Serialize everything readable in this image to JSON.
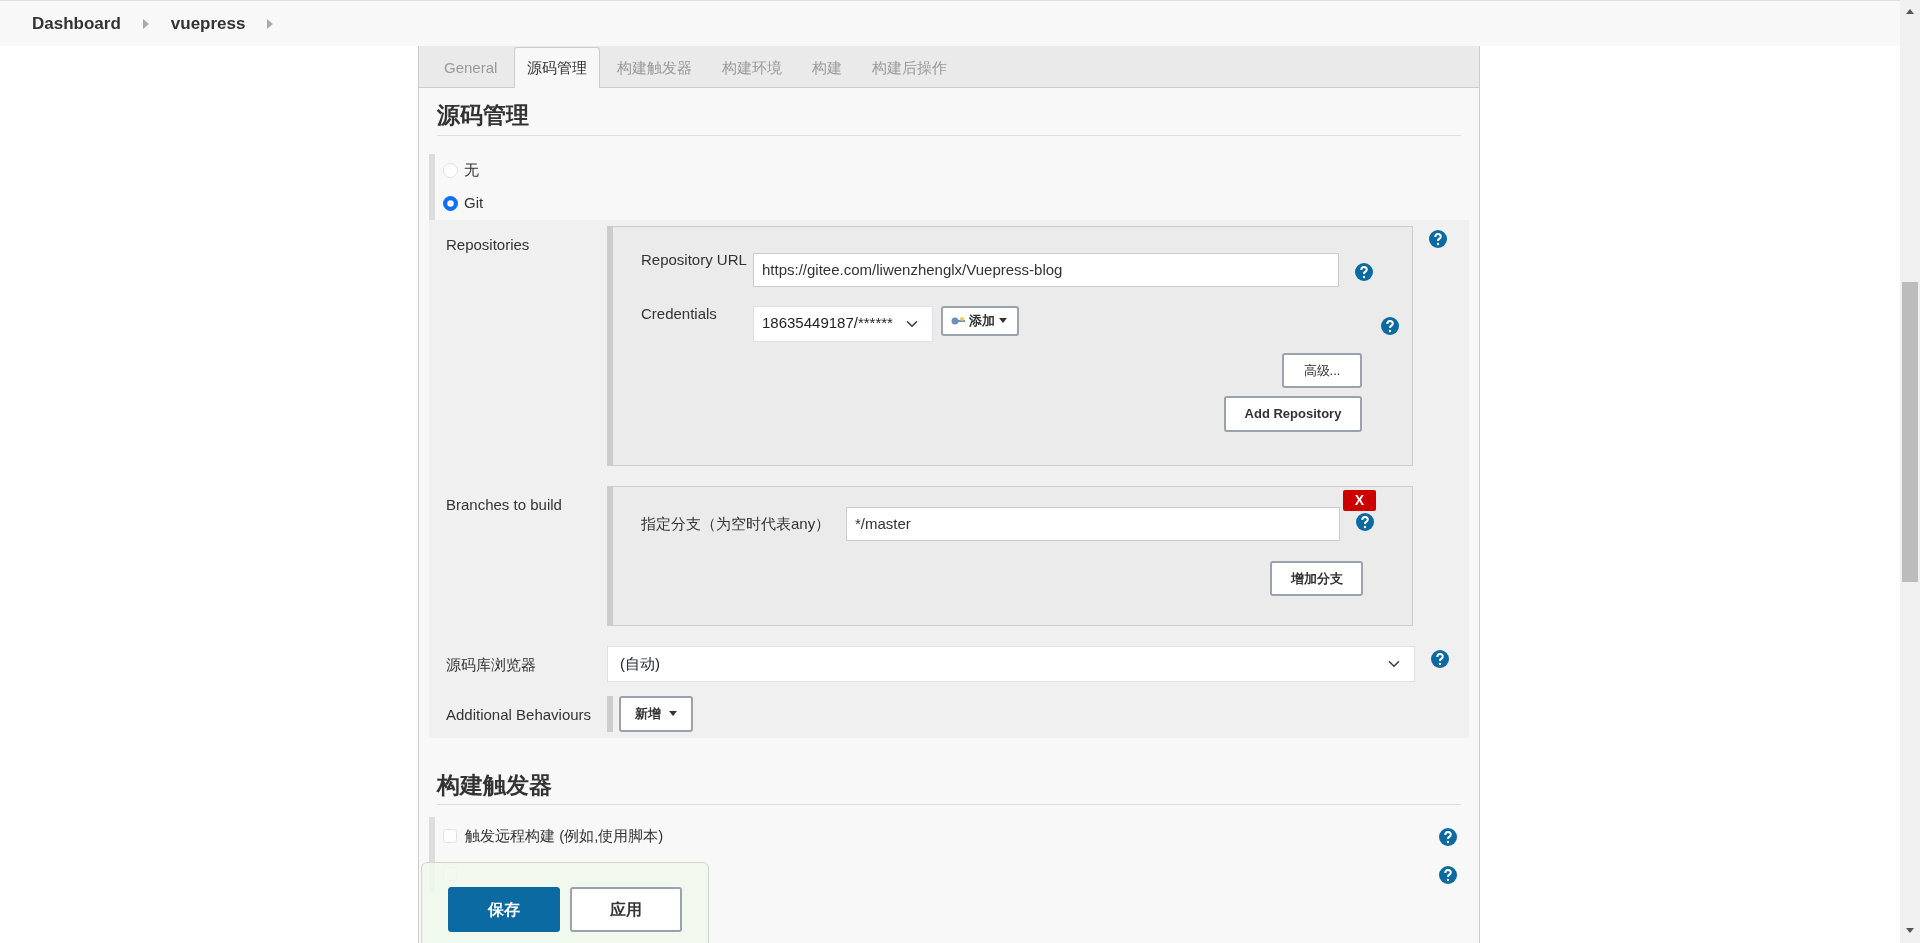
{
  "breadcrumbs": [
    {
      "label": "Dashboard"
    },
    {
      "label": "vuepress"
    }
  ],
  "tabs": [
    {
      "label": "General",
      "selected": false
    },
    {
      "label": "源码管理",
      "selected": true
    },
    {
      "label": "构建触发器",
      "selected": false
    },
    {
      "label": "构建环境",
      "selected": false
    },
    {
      "label": "构建",
      "selected": false
    },
    {
      "label": "构建后操作",
      "selected": false
    }
  ],
  "section_title": "源码管理",
  "scm_options": [
    {
      "label": "无",
      "selected": false
    },
    {
      "label": "Git",
      "selected": true
    }
  ],
  "repositories": {
    "label": "Repositories",
    "url_label": "Repository URL",
    "url": "https://gitee.com/liwenzhenglx/Vuepress-blog",
    "credentials_label": "Credentials",
    "credentials_value": "18635449187/******",
    "add_button": "添加",
    "advanced_button": "高级...",
    "add_repository_button": "Add Repository"
  },
  "branches": {
    "label": "Branches to build",
    "branch_label": "指定分支（为空时代表any）",
    "branch_value": "*/master",
    "delete_button": "X",
    "add_branch_button": "增加分支"
  },
  "repo_browser": {
    "label": "源码库浏览器",
    "value": "(自动)"
  },
  "additional_behaviours": {
    "label": "Additional Behaviours",
    "button": "新增"
  },
  "triggers": {
    "title": "构建触发器",
    "items": [
      {
        "label": "触发远程构建 (例如,使用脚本)",
        "checked": false
      },
      {
        "checked": false
      }
    ]
  },
  "footer_buttons": [
    {
      "label": "保存",
      "kind": "primary"
    },
    {
      "label": "应用",
      "kind": "secondary"
    }
  ]
}
